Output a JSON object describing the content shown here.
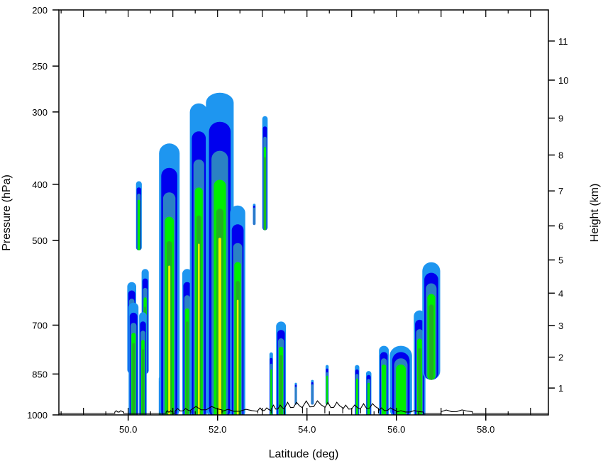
{
  "chart_data": {
    "type": "heatmap",
    "title": "",
    "xlabel": "Latitude (deg)",
    "ylabel": "Pressure (hPa)",
    "y2label": "Height (km)",
    "xlim": [
      48.45,
      59.4
    ],
    "ylim_pressure": [
      1000,
      200
    ],
    "y_scale": "log",
    "x_ticks": [
      50.0,
      52.0,
      54.0,
      56.0,
      58.0
    ],
    "x_tick_labels": [
      "50.0",
      "52.0",
      "54.0",
      "56.0",
      "58.0"
    ],
    "y_ticks": [
      1000,
      850,
      700,
      500,
      400,
      300,
      250,
      200
    ],
    "y_tick_labels": [
      "1000",
      "850",
      "700",
      "500",
      "400",
      "300",
      "250",
      "200"
    ],
    "y2_ticks_km": [
      1,
      2,
      3,
      4,
      5,
      6,
      7,
      8,
      9,
      10,
      11
    ],
    "y2_tick_labels": [
      "1",
      "2",
      "3",
      "4",
      "5",
      "6",
      "7",
      "8",
      "9",
      "10",
      "11"
    ],
    "grid": false,
    "legend": "none",
    "level_colors": [
      "#1e96f0",
      "#0000ee",
      "#2b81c4",
      "#00ee00",
      "#22b022",
      "#ffee00"
    ],
    "colors": {
      "frame": "#000000",
      "terrain": "#000000",
      "background": "#ffffff"
    },
    "cells": [
      {
        "lat": 50.08,
        "width": 0.2,
        "p_bottom": 850,
        "p_top": 590
      },
      {
        "lat": 50.38,
        "width": 0.16,
        "p_bottom": 850,
        "p_top": 560
      },
      {
        "lat": 50.24,
        "width": 0.13,
        "p_bottom": 520,
        "p_top": 395
      },
      {
        "lat": 50.12,
        "width": 0.22,
        "p_bottom": 1000,
        "p_top": 640
      },
      {
        "lat": 50.33,
        "width": 0.17,
        "p_bottom": 1000,
        "p_top": 665
      },
      {
        "lat": 50.72,
        "width": 0.07,
        "p_bottom": 1000,
        "p_top": 860
      },
      {
        "lat": 50.92,
        "width": 0.46,
        "p_bottom": 1000,
        "p_top": 340
      },
      {
        "lat": 51.32,
        "width": 0.22,
        "p_bottom": 1000,
        "p_top": 560
      },
      {
        "lat": 51.58,
        "width": 0.4,
        "p_bottom": 1000,
        "p_top": 290
      },
      {
        "lat": 52.05,
        "width": 0.62,
        "p_bottom": 1000,
        "p_top": 278
      },
      {
        "lat": 52.45,
        "width": 0.34,
        "p_bottom": 1000,
        "p_top": 435
      },
      {
        "lat": 52.82,
        "width": 0.06,
        "p_bottom": 470,
        "p_top": 432
      },
      {
        "lat": 53.06,
        "width": 0.12,
        "p_bottom": 480,
        "p_top": 305
      },
      {
        "lat": 53.2,
        "width": 0.08,
        "p_bottom": 1000,
        "p_top": 780
      },
      {
        "lat": 53.42,
        "width": 0.22,
        "p_bottom": 1000,
        "p_top": 690
      },
      {
        "lat": 53.75,
        "width": 0.05,
        "p_bottom": 960,
        "p_top": 880
      },
      {
        "lat": 54.12,
        "width": 0.06,
        "p_bottom": 960,
        "p_top": 870
      },
      {
        "lat": 54.45,
        "width": 0.07,
        "p_bottom": 960,
        "p_top": 820
      },
      {
        "lat": 55.12,
        "width": 0.1,
        "p_bottom": 1000,
        "p_top": 820
      },
      {
        "lat": 55.38,
        "width": 0.12,
        "p_bottom": 1000,
        "p_top": 840
      },
      {
        "lat": 55.72,
        "width": 0.22,
        "p_bottom": 1000,
        "p_top": 760
      },
      {
        "lat": 56.1,
        "width": 0.5,
        "p_bottom": 1000,
        "p_top": 760
      },
      {
        "lat": 56.52,
        "width": 0.26,
        "p_bottom": 1000,
        "p_top": 660
      },
      {
        "lat": 56.78,
        "width": 0.4,
        "p_bottom": 870,
        "p_top": 545
      }
    ]
  }
}
